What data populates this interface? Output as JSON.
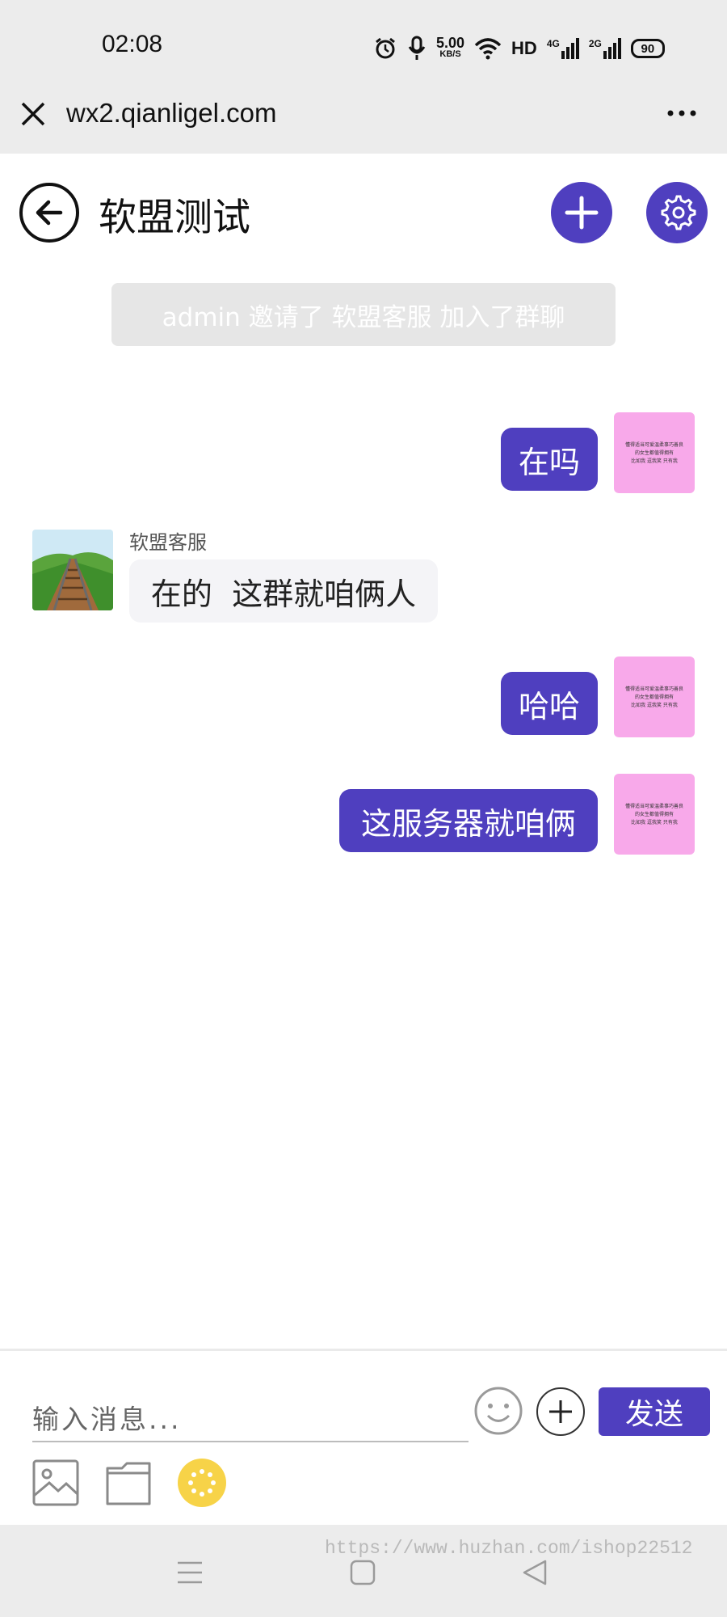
{
  "status_bar": {
    "time": "02:08",
    "net_speed_value": "5.00",
    "net_speed_unit": "KB/S",
    "hd": "HD",
    "net_4g": "4G",
    "net_2g": "2G",
    "battery": "90"
  },
  "browser": {
    "url": "wx2.qianligel.com"
  },
  "chat": {
    "title": "软盟测试",
    "system_message": "admin 邀请了 软盟客服 加入了群聊",
    "messages": [
      {
        "from": "me",
        "text": "在吗"
      },
      {
        "from": "other",
        "sender": "软盟客服",
        "text": "在的  这群就咱俩人"
      },
      {
        "from": "me",
        "text": "哈哈"
      },
      {
        "from": "me",
        "text": "这服务器就咱俩"
      }
    ],
    "my_avatar_lines": [
      "懂得适当可爱温柔事巧善良",
      "的女生都值得拥有",
      "比如我 逗我笑 只有我"
    ]
  },
  "footer": {
    "input_placeholder": "输入消息...",
    "send_label": "发送"
  },
  "watermark": "https://www.huzhan.com/ishop22512",
  "colors": {
    "accent": "#4f3fbf",
    "my_avatar_bg": "#f8a9ea",
    "status_bg": "#ececec"
  }
}
